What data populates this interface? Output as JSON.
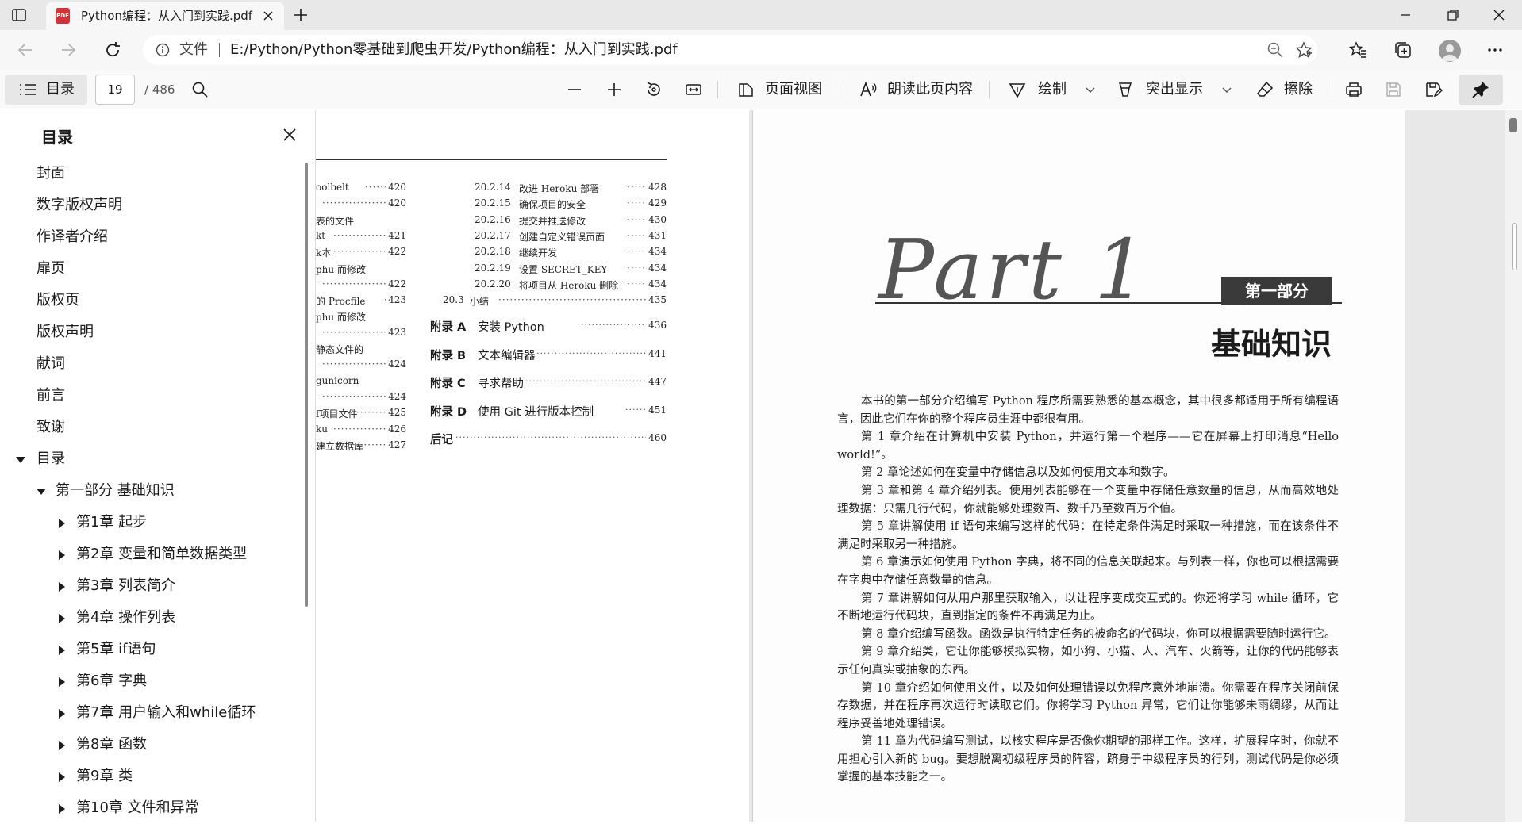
{
  "browser": {
    "tab_title": "Python编程：从入门到实践.pdf",
    "tab_file_badge": "PDF",
    "address_label": "文件",
    "url": "E:/Python/Python零基础到爬虫开发/Python编程：从入门到实践.pdf"
  },
  "pdf_toolbar": {
    "toc_label": "目录",
    "page_current": "19",
    "page_total": "/ 486",
    "page_view_label": "页面视图",
    "read_aloud_label": "朗读此页内容",
    "draw_label": "绘制",
    "highlight_label": "突出显示",
    "erase_label": "擦除"
  },
  "toc": {
    "heading": "目录",
    "items": [
      {
        "label": "封面",
        "level": 0,
        "expander": "none"
      },
      {
        "label": "数字版权声明",
        "level": 0,
        "expander": "none"
      },
      {
        "label": "作译者介绍",
        "level": 0,
        "expander": "none"
      },
      {
        "label": "扉页",
        "level": 0,
        "expander": "none"
      },
      {
        "label": "版权页",
        "level": 0,
        "expander": "none"
      },
      {
        "label": "版权声明",
        "level": 0,
        "expander": "none"
      },
      {
        "label": "献词",
        "level": 0,
        "expander": "none"
      },
      {
        "label": "前言",
        "level": 0,
        "expander": "none"
      },
      {
        "label": "致谢",
        "level": 0,
        "expander": "none"
      },
      {
        "label": "目录",
        "level": 0,
        "expander": "expanded"
      },
      {
        "label": "第一部分 基础知识",
        "level": 1,
        "expander": "expanded"
      },
      {
        "label": "第1章 起步",
        "level": 2,
        "expander": "collapsed"
      },
      {
        "label": "第2章 变量和简单数据类型",
        "level": 2,
        "expander": "collapsed"
      },
      {
        "label": "第3章 列表简介",
        "level": 2,
        "expander": "collapsed"
      },
      {
        "label": "第4章 操作列表",
        "level": 2,
        "expander": "collapsed"
      },
      {
        "label": "第5章 if语句",
        "level": 2,
        "expander": "collapsed"
      },
      {
        "label": "第6章 字典",
        "level": 2,
        "expander": "collapsed"
      },
      {
        "label": "第7章 用户输入和while循环",
        "level": 2,
        "expander": "collapsed"
      },
      {
        "label": "第8章 函数",
        "level": 2,
        "expander": "collapsed"
      },
      {
        "label": "第9章 类",
        "level": 2,
        "expander": "collapsed"
      },
      {
        "label": "第10章 文件和异常",
        "level": 2,
        "expander": "collapsed"
      }
    ]
  },
  "left_page": {
    "col1": [
      {
        "text": "oolbelt",
        "page": "420"
      },
      {
        "text": "",
        "page": "420"
      },
      {
        "text": "表的文件",
        "page": ""
      },
      {
        "text": "kt",
        "page": "421"
      },
      {
        "text": "k本",
        "page": "422"
      },
      {
        "text": "phu 而修改",
        "page": ""
      },
      {
        "text": "",
        "page": "422"
      },
      {
        "text": "的 Procfile",
        "page": "423"
      },
      {
        "text": "phu 而修改",
        "page": ""
      },
      {
        "text": "",
        "page": "423"
      },
      {
        "text": "静态文件的",
        "page": ""
      },
      {
        "text": "",
        "page": "424"
      },
      {
        "text": "gunicorn",
        "page": ""
      },
      {
        "text": "",
        "page": "424"
      },
      {
        "text": "f项目文件",
        "page": "425"
      },
      {
        "text": "ku",
        "page": "426"
      },
      {
        "text": "建立数据库",
        "page": "427"
      }
    ],
    "col2": [
      {
        "num": "20.2.14",
        "text": "改进 Heroku 部署",
        "page": "428"
      },
      {
        "num": "20.2.15",
        "text": "确保项目的安全",
        "page": "429"
      },
      {
        "num": "20.2.16",
        "text": "提交并推送修改",
        "page": "430"
      },
      {
        "num": "20.2.17",
        "text": "创建自定义错误页面",
        "page": "431"
      },
      {
        "num": "20.2.18",
        "text": "继续开发",
        "page": "434"
      },
      {
        "num": "20.2.19",
        "text": "设置 SECRET_KEY",
        "page": "434"
      },
      {
        "num": "20.2.20",
        "text": "将项目从 Heroku 删除",
        "page": "434"
      },
      {
        "num": "20.3",
        "text": "小结",
        "page": "435"
      }
    ],
    "appendices": [
      {
        "num": "附录 A",
        "title": "安装 Python",
        "page": "436"
      },
      {
        "num": "附录 B",
        "title": "文本编辑器",
        "page": "441"
      },
      {
        "num": "附录 C",
        "title": "寻求帮助",
        "page": "447"
      },
      {
        "num": "附录 D",
        "title": "使用 Git 进行版本控制",
        "page": "451"
      },
      {
        "num": "后记",
        "title": "",
        "page": "460"
      }
    ]
  },
  "right_page": {
    "part_text": "Part 1",
    "part_badge": "第一部分",
    "title": "基础知识",
    "paragraphs": [
      "本书的第一部分介绍编写 Python 程序所需要熟悉的基本概念，其中很多都适用于所有编程语言，因此它们在你的整个程序员生涯中都很有用。",
      "第 1 章介绍在计算机中安装 Python，并运行第一个程序——它在屏幕上打印消息“Hello world!”。",
      "第 2 章论述如何在变量中存储信息以及如何使用文本和数字。",
      "第 3 章和第 4 章介绍列表。使用列表能够在一个变量中存储任意数量的信息，从而高效地处理数据：只需几行代码，你就能够处理数百、数千乃至数百万个值。",
      "第 5 章讲解使用 if 语句来编写这样的代码：在特定条件满足时采取一种措施，而在该条件不满足时采取另一种措施。",
      "第 6 章演示如何使用 Python 字典，将不同的信息关联起来。与列表一样，你也可以根据需要在字典中存储任意数量的信息。",
      "第 7 章讲解如何从用户那里获取输入，以让程序变成交互式的。你还将学习 while 循环，它不断地运行代码块，直到指定的条件不再满足为止。",
      "第 8 章介绍编写函数。函数是执行特定任务的被命名的代码块，你可以根据需要随时运行它。",
      "第 9 章介绍类，它让你能够模拟实物，如小狗、小猫、人、汽车、火箭等，让你的代码能够表示任何真实或抽象的东西。",
      "第 10 章介绍如何使用文件，以及如何处理错误以免程序意外地崩溃。你需要在程序关闭前保存数据，并在程序再次运行时读取它们。你将学习 Python 异常，它们让你能够未雨绸缪，从而让程序妥善地处理错误。",
      "第 11 章为代码编写测试，以核实程序是否像你期望的那样工作。这样，扩展程序时，你就不用担心引入新的 bug。要想脱离初级程序员的阵容，跻身于中级程序员的行列，测试代码是你必须掌握的基本技能之一。"
    ]
  }
}
